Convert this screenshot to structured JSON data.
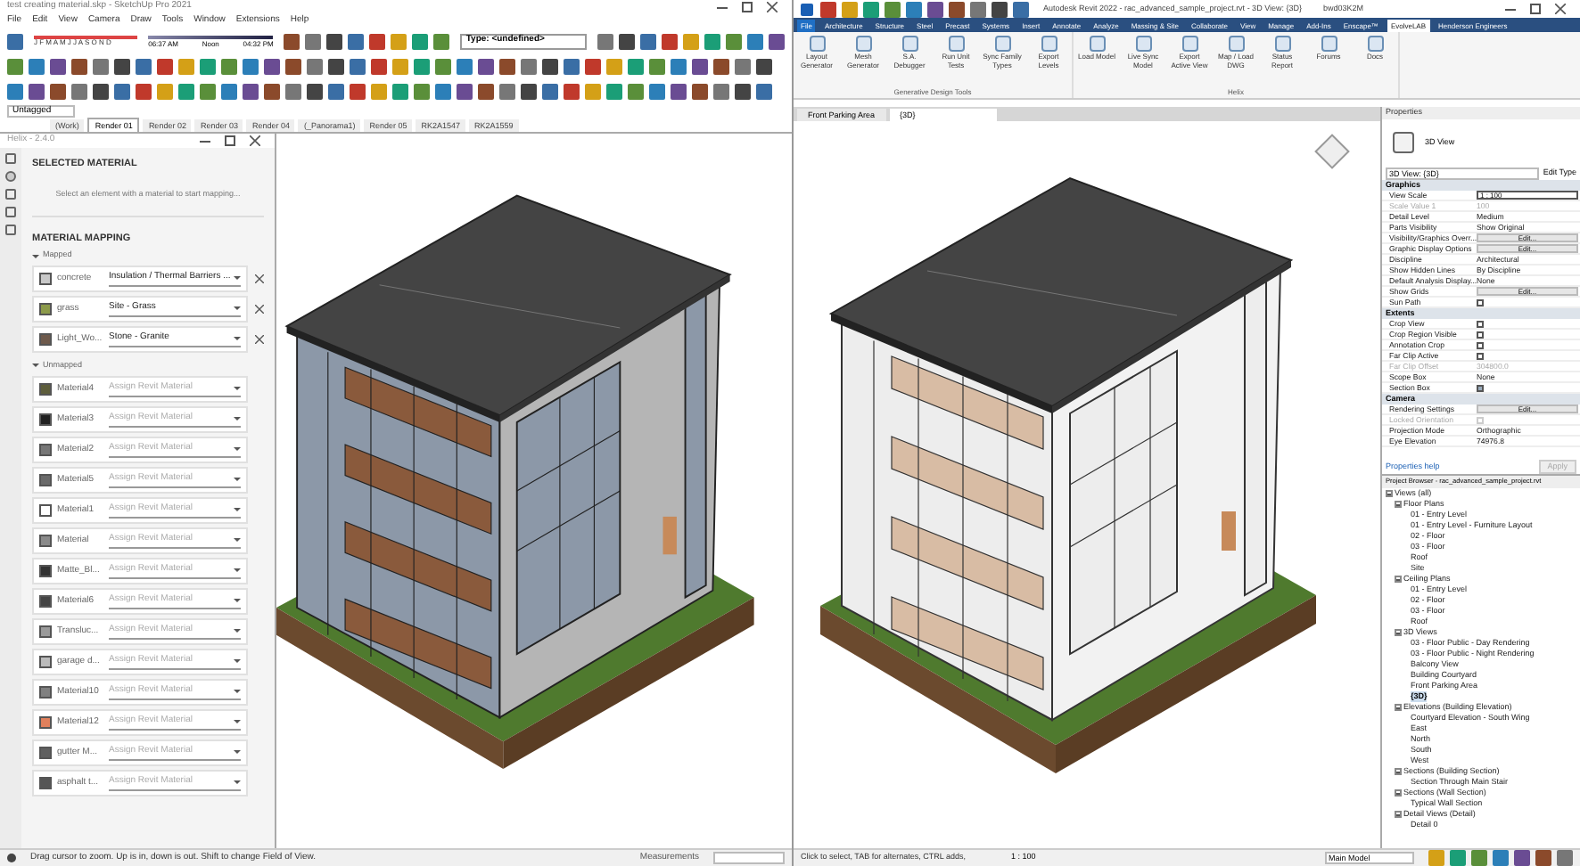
{
  "sketchup": {
    "title": "test creating material.skp - SketchUp Pro 2021",
    "menu": [
      "File",
      "Edit",
      "View",
      "Camera",
      "Draw",
      "Tools",
      "Window",
      "Extensions",
      "Help"
    ],
    "months": "J F M A M J J A S O N D",
    "time_start": "06:37 AM",
    "time_mid": "Noon",
    "time_end": "04:32 PM",
    "type_field": "Type: <undefined>",
    "tag_field": "Untagged",
    "scene_tabs": [
      {
        "label": "(Work)",
        "selected": false
      },
      {
        "label": "Render 01",
        "selected": true
      },
      {
        "label": "Render 02",
        "selected": false
      },
      {
        "label": "Render 03",
        "selected": false
      },
      {
        "label": "Render 04",
        "selected": false
      },
      {
        "label": "(_Panorama1)",
        "selected": false
      },
      {
        "label": "Render 05",
        "selected": false
      },
      {
        "label": "RK2A1547",
        "selected": false
      },
      {
        "label": "RK2A1559",
        "selected": false
      }
    ],
    "status": "Drag cursor to zoom.  Up is in, down is out.  Shift to change Field of View.",
    "measurements": "Measurements"
  },
  "helix": {
    "title": "Helix - 2.4.0",
    "selected_heading": "SELECTED MATERIAL",
    "selected_hint": "Select an element with a material to start mapping...",
    "mapping_heading": "MATERIAL MAPPING",
    "mapped_label": "Mapped",
    "mapped": [
      {
        "name": "concrete",
        "value": "Insulation / Thermal Barriers ...",
        "color": "#c8c8c8"
      },
      {
        "name": "grass",
        "value": "Site - Grass",
        "color": "#8c9a4a"
      },
      {
        "name": "Light_Wo...",
        "value": "Stone - Granite",
        "color": "#6e5a4c"
      }
    ],
    "unmapped_label": "Unmapped",
    "unmapped": [
      {
        "name": "Material4",
        "placeholder": "Assign Revit Material",
        "color": "#5e5e3c"
      },
      {
        "name": "Material3",
        "placeholder": "Assign Revit Material",
        "color": "#222222"
      },
      {
        "name": "Material2",
        "placeholder": "Assign Revit Material",
        "color": "#777777"
      },
      {
        "name": "Material5",
        "placeholder": "Assign Revit Material",
        "color": "#6a6a6a"
      },
      {
        "name": "Material1",
        "placeholder": "Assign Revit Material",
        "color": "#ffffff"
      },
      {
        "name": "Material",
        "placeholder": "Assign Revit Material",
        "color": "#8a8a8a"
      },
      {
        "name": "Matte_Bl...",
        "placeholder": "Assign Revit Material",
        "color": "#333333"
      },
      {
        "name": "Material6",
        "placeholder": "Assign Revit Material",
        "color": "#444444"
      },
      {
        "name": "Transluc...",
        "placeholder": "Assign Revit Material",
        "color": "#9a9a9a"
      },
      {
        "name": "garage d...",
        "placeholder": "Assign Revit Material",
        "color": "#bbbbbb"
      },
      {
        "name": "Material10",
        "placeholder": "Assign Revit Material",
        "color": "#808080"
      },
      {
        "name": "Material12",
        "placeholder": "Assign Revit Material",
        "color": "#e0805c"
      },
      {
        "name": "gutter M...",
        "placeholder": "Assign Revit Material",
        "color": "#606060"
      },
      {
        "name": "asphalt t...",
        "placeholder": "Assign Revit Material",
        "color": "#555555"
      }
    ]
  },
  "revit": {
    "title": "Autodesk Revit 2022 - rac_advanced_sample_project.rvt - 3D View: {3D}",
    "user": "bwd03K2M",
    "ribbon_tabs": [
      {
        "label": "File",
        "selected": false
      },
      {
        "label": "Architecture",
        "selected": false
      },
      {
        "label": "Structure",
        "selected": false
      },
      {
        "label": "Steel",
        "selected": false
      },
      {
        "label": "Precast",
        "selected": false
      },
      {
        "label": "Systems",
        "selected": false
      },
      {
        "label": "Insert",
        "selected": false
      },
      {
        "label": "Annotate",
        "selected": false
      },
      {
        "label": "Analyze",
        "selected": false
      },
      {
        "label": "Massing & Site",
        "selected": false
      },
      {
        "label": "Collaborate",
        "selected": false
      },
      {
        "label": "View",
        "selected": false
      },
      {
        "label": "Manage",
        "selected": false
      },
      {
        "label": "Add-Ins",
        "selected": false
      },
      {
        "label": "Enscape™",
        "selected": false
      },
      {
        "label": "EvolveLAB",
        "selected": true
      },
      {
        "label": "Henderson Engineers",
        "selected": false
      }
    ],
    "ribbon_groups": [
      {
        "label": "Generative Design Tools",
        "buttons": [
          "Layout Generator",
          "Mesh Generator",
          "S.A. Debugger",
          "Run Unit Tests",
          "Sync Family Types",
          "Export Levels"
        ]
      },
      {
        "label": "Helix",
        "buttons": [
          "Load Model",
          "Live Sync Model",
          "Export Active View",
          "Map / Load DWG",
          "Status Report",
          "Forums",
          "Docs"
        ]
      }
    ],
    "view_tabs": [
      {
        "label": "Front Parking Area",
        "selected": false
      },
      {
        "label": "{3D}",
        "selected": true
      }
    ],
    "properties": {
      "title": "Properties",
      "type": "3D View",
      "selector": "3D View: {3D}",
      "edit_type": "Edit Type",
      "sections": [
        {
          "name": "Graphics",
          "rows": [
            {
              "label": "View Scale",
              "value": "1 : 100",
              "kind": "field",
              "disabled": false
            },
            {
              "label": "Scale Value    1",
              "value": "100",
              "kind": "text",
              "disabled": true
            },
            {
              "label": "Detail Level",
              "value": "Medium",
              "kind": "text",
              "disabled": false
            },
            {
              "label": "Parts Visibility",
              "value": "Show Original",
              "kind": "text",
              "disabled": false
            },
            {
              "label": "Visibility/Graphics Overr...",
              "value": "Edit...",
              "kind": "button",
              "disabled": false
            },
            {
              "label": "Graphic Display Options",
              "value": "Edit...",
              "kind": "button",
              "disabled": false
            },
            {
              "label": "Discipline",
              "value": "Architectural",
              "kind": "text",
              "disabled": false
            },
            {
              "label": "Show Hidden Lines",
              "value": "By Discipline",
              "kind": "text",
              "disabled": false
            },
            {
              "label": "Default Analysis Display...",
              "value": "None",
              "kind": "text",
              "disabled": false
            },
            {
              "label": "Show Grids",
              "value": "Edit...",
              "kind": "button",
              "disabled": false
            },
            {
              "label": "Sun Path",
              "kind": "checkbox",
              "checked": false,
              "disabled": false
            }
          ]
        },
        {
          "name": "Extents",
          "rows": [
            {
              "label": "Crop View",
              "kind": "checkbox",
              "checked": false,
              "disabled": false
            },
            {
              "label": "Crop Region Visible",
              "kind": "checkbox",
              "checked": false,
              "disabled": false
            },
            {
              "label": "Annotation Crop",
              "kind": "checkbox",
              "checked": false,
              "disabled": false
            },
            {
              "label": "Far Clip Active",
              "kind": "checkbox",
              "checked": false,
              "disabled": false
            },
            {
              "label": "Far Clip Offset",
              "value": "304800.0",
              "kind": "text",
              "disabled": true
            },
            {
              "label": "Scope Box",
              "value": "None",
              "kind": "text",
              "disabled": false
            },
            {
              "label": "Section Box",
              "kind": "checkbox",
              "checked": true,
              "disabled": false
            }
          ]
        },
        {
          "name": "Camera",
          "rows": [
            {
              "label": "Rendering Settings",
              "value": "Edit...",
              "kind": "button",
              "disabled": false
            },
            {
              "label": "Locked Orientation",
              "kind": "checkbox",
              "checked": false,
              "disabled": true
            },
            {
              "label": "Projection Mode",
              "value": "Orthographic",
              "kind": "text",
              "disabled": false
            },
            {
              "label": "Eye Elevation",
              "value": "74976.8",
              "kind": "text",
              "disabled": false
            }
          ]
        }
      ],
      "help": "Properties help",
      "apply": "Apply"
    },
    "browser": {
      "title": "Project Browser - rac_advanced_sample_project.rvt",
      "tree": [
        {
          "label": "Views (all)",
          "expanded": true,
          "selected": false,
          "children": [
            {
              "label": "Floor Plans",
              "expanded": true,
              "selected": false,
              "children": [
                {
                  "label": "01 - Entry Level",
                  "selected": false
                },
                {
                  "label": "01 - Entry Level - Furniture Layout",
                  "selected": false
                },
                {
                  "label": "02 - Floor",
                  "selected": false
                },
                {
                  "label": "03 - Floor",
                  "selected": false
                },
                {
                  "label": "Roof",
                  "selected": false
                },
                {
                  "label": "Site",
                  "selected": false
                }
              ]
            },
            {
              "label": "Ceiling Plans",
              "expanded": true,
              "selected": false,
              "children": [
                {
                  "label": "01 - Entry Level",
                  "selected": false
                },
                {
                  "label": "02 - Floor",
                  "selected": false
                },
                {
                  "label": "03 - Floor",
                  "selected": false
                },
                {
                  "label": "Roof",
                  "selected": false
                }
              ]
            },
            {
              "label": "3D Views",
              "expanded": true,
              "selected": false,
              "children": [
                {
                  "label": "03 - Floor Public - Day Rendering",
                  "selected": false
                },
                {
                  "label": "03 - Floor Public - Night Rendering",
                  "selected": false
                },
                {
                  "label": "Balcony View",
                  "selected": false
                },
                {
                  "label": "Building Courtyard",
                  "selected": false
                },
                {
                  "label": "Front Parking Area",
                  "selected": false
                },
                {
                  "label": "{3D}",
                  "selected": true
                }
              ]
            },
            {
              "label": "Elevations (Building Elevation)",
              "expanded": true,
              "selected": false,
              "children": [
                {
                  "label": "Courtyard Elevation - South Wing",
                  "selected": false
                },
                {
                  "label": "East",
                  "selected": false
                },
                {
                  "label": "North",
                  "selected": false
                },
                {
                  "label": "South",
                  "selected": false
                },
                {
                  "label": "West",
                  "selected": false
                }
              ]
            },
            {
              "label": "Sections (Building Section)",
              "expanded": true,
              "selected": false,
              "children": [
                {
                  "label": "Section Through Main Stair",
                  "selected": false
                }
              ]
            },
            {
              "label": "Sections (Wall Section)",
              "expanded": true,
              "selected": false,
              "children": [
                {
                  "label": "Typical Wall Section",
                  "selected": false
                }
              ]
            },
            {
              "label": "Detail Views (Detail)",
              "expanded": true,
              "selected": false,
              "children": [
                {
                  "label": "Detail 0",
                  "selected": false
                }
              ]
            }
          ]
        }
      ]
    },
    "status": "Click to select, TAB for alternates, CTRL adds,",
    "scale": "1 : 100",
    "model": "Main Model"
  }
}
